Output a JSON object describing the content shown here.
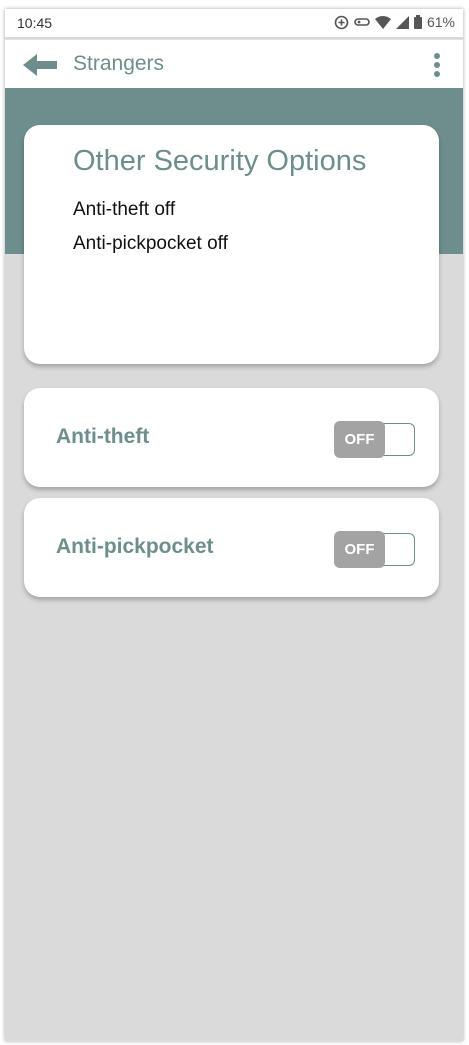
{
  "status_bar": {
    "time": "10:45",
    "battery": "61%"
  },
  "app_bar": {
    "title": "Strangers"
  },
  "info_card": {
    "title": "Other Security Options",
    "lines": [
      "Anti-theft off",
      "Anti-pickpocket off"
    ]
  },
  "toggles": [
    {
      "label": "Anti-theft",
      "state": "OFF"
    },
    {
      "label": "Anti-pickpocket",
      "state": "OFF"
    }
  ],
  "colors": {
    "accent": "#6e8e8e",
    "background": "#dadada",
    "switch_off": "#a3a3a3"
  }
}
